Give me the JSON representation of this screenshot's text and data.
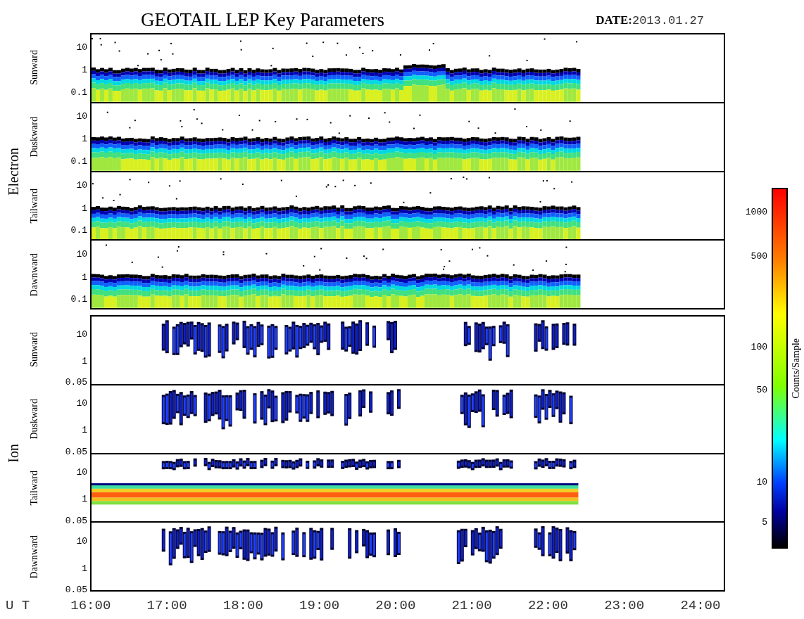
{
  "title": "GEOTAIL LEP Key Parameters",
  "date": {
    "label": "DATE:",
    "value": "2013.01.27"
  },
  "groups": [
    {
      "label": "Electron",
      "panels": [
        {
          "label": "Sunward",
          "kind": "electron",
          "yticks": [
            "10",
            "1",
            "0.1"
          ]
        },
        {
          "label": "Duskward",
          "kind": "electron",
          "yticks": [
            "10",
            "1",
            "0.1"
          ]
        },
        {
          "label": "Tailward",
          "kind": "electron",
          "yticks": [
            "10",
            "1",
            "0.1"
          ]
        },
        {
          "label": "Dawnward",
          "kind": "electron",
          "yticks": [
            "10",
            "1",
            "0.1"
          ]
        }
      ]
    },
    {
      "label": "Ion",
      "panels": [
        {
          "label": "Sunward",
          "kind": "ion",
          "yticks": [
            "10",
            "1",
            "0.05"
          ]
        },
        {
          "label": "Duskward",
          "kind": "ion",
          "yticks": [
            "10",
            "1",
            "0.05"
          ]
        },
        {
          "label": "Tailward",
          "kind": "ion_band",
          "yticks": [
            "10",
            "1",
            "0.05"
          ]
        },
        {
          "label": "Dawnward",
          "kind": "ion",
          "yticks": [
            "10",
            "1",
            "0.05"
          ]
        }
      ]
    }
  ],
  "x_axis": {
    "label": "U T",
    "ticks": [
      "16:00",
      "17:00",
      "18:00",
      "19:00",
      "20:00",
      "21:00",
      "22:00",
      "23:00",
      "24:00"
    ]
  },
  "colorbar": {
    "label": "Counts/Sample",
    "ticks": [
      "1000",
      "500",
      "100",
      "50",
      "10",
      "5"
    ]
  }
}
